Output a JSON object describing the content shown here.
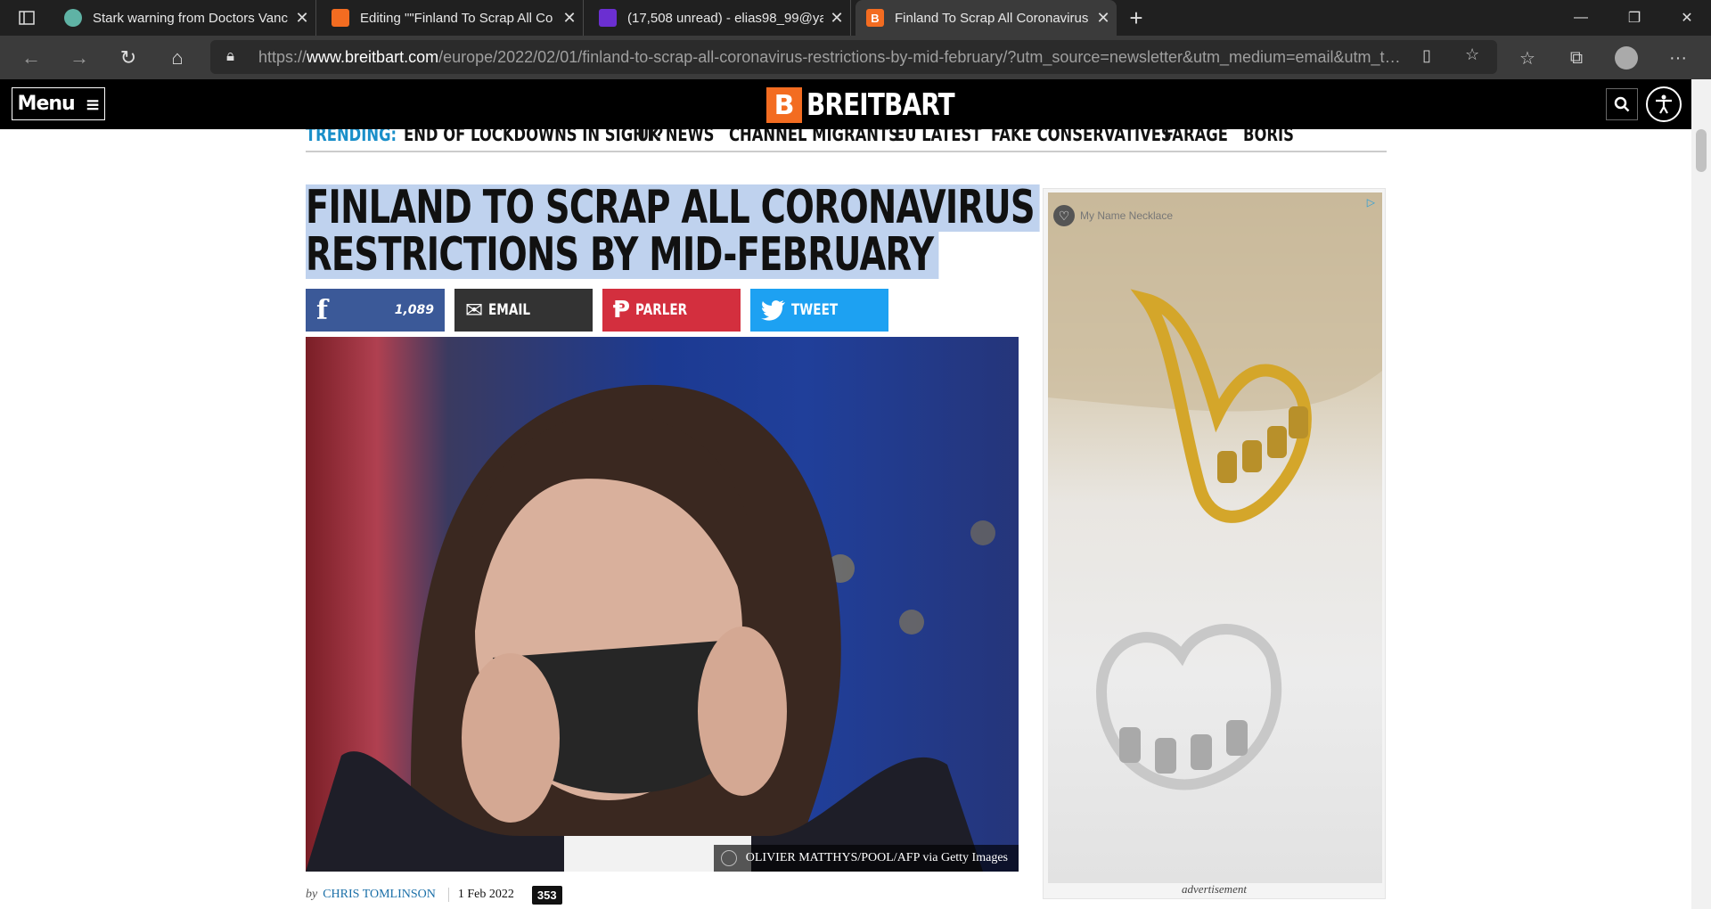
{
  "browser": {
    "tabs": [
      {
        "title": "Stark warning from Doctors Vanc",
        "active": false
      },
      {
        "title": "Editing \"\"Finland To Scrap All Co",
        "active": false
      },
      {
        "title": "(17,508 unread) - elias98_99@ya",
        "active": false
      },
      {
        "title": "Finland To Scrap All Coronavirus",
        "active": true
      }
    ],
    "url_prefix": "https://",
    "url_domain": "www.breitbart.com",
    "url_path": "/europe/2022/02/01/finland-to-scrap-all-coronavirus-restrictions-by-mid-february/?utm_source=newsletter&utm_medium=email&utm_ter..."
  },
  "site": {
    "menu_label": "Menu",
    "logo_letter": "B",
    "logo_text": "BREITBART",
    "trending": [
      "TRENDING:",
      "END OF LOCKDOWNS IN SIGHT?",
      "UK NEWS",
      "CHANNEL MIGRANTS",
      "EU LATEST",
      "FAKE CONSERVATIVES",
      "FARAGE",
      "BORIS"
    ]
  },
  "article": {
    "headline_line1": "FINLAND TO SCRAP ALL CORONAVIRUS",
    "headline_line2": "RESTRICTIONS BY MID-FEBRUARY",
    "share": {
      "facebook_count": "1,089",
      "email": "EMAIL",
      "parler": "PARLER",
      "tweet": "TWEET"
    },
    "photo_credit": "OLIVIER MATTHYS/POOL/AFP via Getty Images",
    "byline_prefix": "by",
    "author": "CHRIS TOMLINSON",
    "date": "1 Feb 2022",
    "comment_count": "353"
  },
  "ad": {
    "caption": "My Name Necklace",
    "label": "advertisement"
  },
  "colors": {
    "facebook": "#3b5998",
    "email": "#333333",
    "parler": "#d32f3e",
    "tweet": "#1da1f2",
    "brand": "#f36c21",
    "selection": "#bfd2ee"
  }
}
